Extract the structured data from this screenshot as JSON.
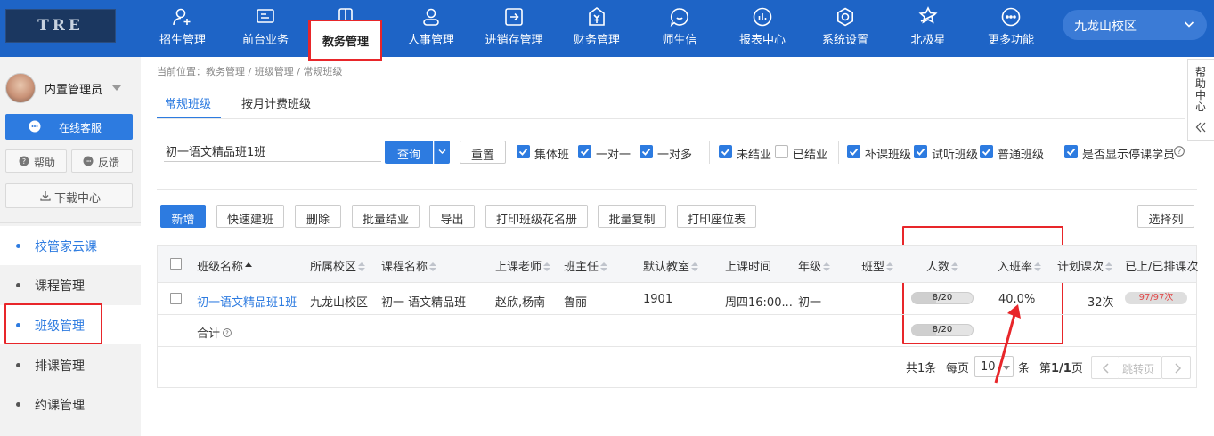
{
  "logo": {
    "text": "TRE"
  },
  "nav": [
    {
      "label": "招生管理",
      "icon": "add-user-icon"
    },
    {
      "label": "前台业务",
      "icon": "monitor-icon"
    },
    {
      "label": "教务管理",
      "icon": "book-icon",
      "active": true
    },
    {
      "label": "人事管理",
      "icon": "person-icon"
    },
    {
      "label": "进销存管理",
      "icon": "box-arrow-icon"
    },
    {
      "label": "财务管理",
      "icon": "yen-shield-icon"
    },
    {
      "label": "师生信",
      "icon": "chat-icon"
    },
    {
      "label": "报表中心",
      "icon": "chart-icon"
    },
    {
      "label": "系统设置",
      "icon": "gear-icon"
    },
    {
      "label": "北极星",
      "icon": "star-icon"
    },
    {
      "label": "更多功能",
      "icon": "more-icon"
    }
  ],
  "campus": {
    "name": "九龙山校区"
  },
  "sidebar": {
    "user_name": "内置管理员",
    "online_service": "在线客服",
    "help": "帮助",
    "feedback": "反馈",
    "download": "下载中心",
    "menu": [
      {
        "label": "校管家云课"
      },
      {
        "label": "课程管理"
      },
      {
        "label": "班级管理"
      },
      {
        "label": "排课管理"
      },
      {
        "label": "约课管理"
      }
    ]
  },
  "breadcrumb": "当前位置：教务管理 / 班级管理 / 常规班级",
  "tabs": [
    {
      "label": "常规班级"
    },
    {
      "label": "按月计费班级"
    }
  ],
  "help_center": "帮助中心",
  "filters": {
    "search_value": "初一语文精品班1班",
    "query_label": "查询",
    "reset_label": "重置",
    "checkboxes": [
      {
        "label": "集体班",
        "checked": true
      },
      {
        "label": "一对一",
        "checked": true
      },
      {
        "label": "一对多",
        "checked": true
      },
      {
        "label": "未结业",
        "checked": true
      },
      {
        "label": "已结业",
        "checked": false
      },
      {
        "label": "补课班级",
        "checked": true
      },
      {
        "label": "试听班级",
        "checked": true
      },
      {
        "label": "普通班级",
        "checked": true
      },
      {
        "label": "是否显示停课学员",
        "checked": true
      }
    ]
  },
  "toolbar": {
    "new": "新增",
    "quick_create": "快速建班",
    "delete": "删除",
    "batch_graduate": "批量结业",
    "export": "导出",
    "print_roster": "打印班级花名册",
    "batch_copy": "批量复制",
    "print_seats": "打印座位表",
    "select_columns": "选择列"
  },
  "table": {
    "columns": [
      "班级名称",
      "所属校区",
      "课程名称",
      "上课老师",
      "班主任",
      "默认教室",
      "上课时间",
      "年级",
      "班型",
      "人数",
      "入班率",
      "计划课次",
      "已上/已排课次"
    ],
    "rows": [
      {
        "class_name": "初一语文精品班1班",
        "campus": "九龙山校区",
        "course": "初一 语文精品班",
        "teachers": "赵欣,杨南",
        "head_teacher": "鲁丽",
        "classroom": "1901",
        "time": "周四16:00...",
        "grade": "初一",
        "class_type": "",
        "count_text": "8/20",
        "count_fraction": 0.4,
        "rate": "40.0%",
        "planned": "32次",
        "scheduled": "97/97次"
      }
    ],
    "total_label": "合计",
    "total_count_text": "8/20",
    "total_count_fraction": 0.4
  },
  "pagination": {
    "total": "共1条",
    "per_page_label": "每页",
    "per_page": "10",
    "unit": "条",
    "page_prefix": "第",
    "page_current": "1/1",
    "page_suffix": "页",
    "jump": "跳转页"
  },
  "colors": {
    "primary": "#2d7be0",
    "topbar": "#1e64c6",
    "highlight": "#e8262a"
  }
}
